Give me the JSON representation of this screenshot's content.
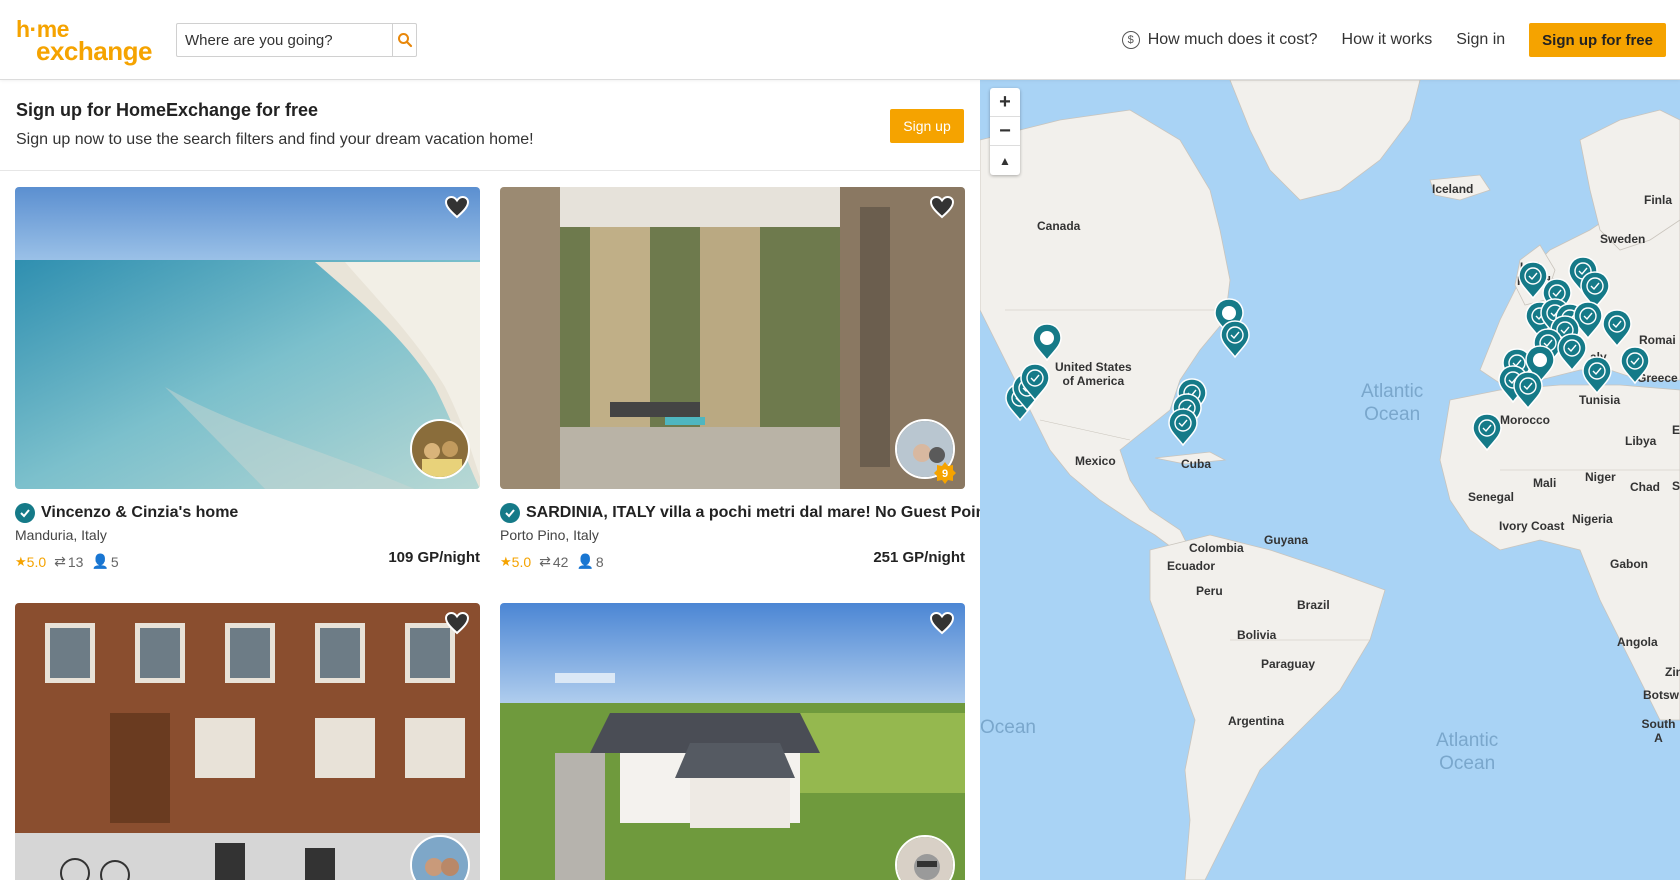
{
  "header": {
    "logo_line1": "h·me",
    "logo_line2": "exchange",
    "search_placeholder": "Where are you going?",
    "nav": {
      "cost": "How much does it cost?",
      "how": "How it works",
      "signin": "Sign in",
      "signup": "Sign up for free"
    }
  },
  "banner": {
    "title": "Sign up for HomeExchange for free",
    "subtitle": "Sign up now to use the search filters and find your dream vacation home!",
    "button": "Sign up"
  },
  "listings": [
    {
      "title": "Vincenzo & Cinzia's home",
      "location": "Manduria, Italy",
      "rating": "5.0",
      "exchanges": "13",
      "guests": "5",
      "price": "109 GP/night"
    },
    {
      "title": "SARDINIA, ITALY villa a pochi metri dal mare! No Guest Point",
      "location": "Porto Pino, Italy",
      "rating": "5.0",
      "exchanges": "42",
      "guests": "8",
      "price": "251 GP/night",
      "badge": "9"
    },
    {
      "title": "",
      "location": "",
      "rating": "",
      "exchanges": "",
      "guests": "",
      "price": ""
    },
    {
      "title": "",
      "location": "",
      "rating": "",
      "exchanges": "",
      "guests": "",
      "price": ""
    }
  ],
  "map": {
    "labels": {
      "iceland": "Iceland",
      "canada": "Canada",
      "finland": "Finla",
      "sweden": "Sweden",
      "uk1": "Uni",
      "uk2": "Kingdo",
      "usa1": "United States",
      "usa2": "of America",
      "romania": "Romai",
      "italy": "aly",
      "greece": "Greece",
      "spain": "n",
      "morocco": "Morocco",
      "tunisia": "Tunisia",
      "libya": "Libya",
      "mexico": "Mexico",
      "cuba": "Cuba",
      "mali": "Mali",
      "niger": "Niger",
      "chad": "Chad",
      "senegal": "Senegal",
      "ivory": "Ivory Coast",
      "nigeria": "Nigeria",
      "colombia": "Colombia",
      "guyana": "Guyana",
      "ecuador": "Ecuador",
      "peru": "Peru",
      "brazil": "Brazil",
      "gabon": "Gabon",
      "bolivia": "Bolivia",
      "paraguay": "Paraguay",
      "angola": "Angola",
      "zim": "Zin",
      "botswana": "Botsw",
      "southafrica": "South A",
      "argentina": "Argentina",
      "atlantic1a": "Atlantic",
      "atlantic1b": "Ocean",
      "atlantic2a": "Atlantic",
      "atlantic2b": "Ocean",
      "pacific": "Ocean",
      "e_edge": "E",
      "s_edge": "S"
    }
  },
  "colors": {
    "accent": "#f5a300",
    "pin": "#157a88",
    "ocean": "#a9d3f5",
    "land": "#f2f0ec"
  }
}
